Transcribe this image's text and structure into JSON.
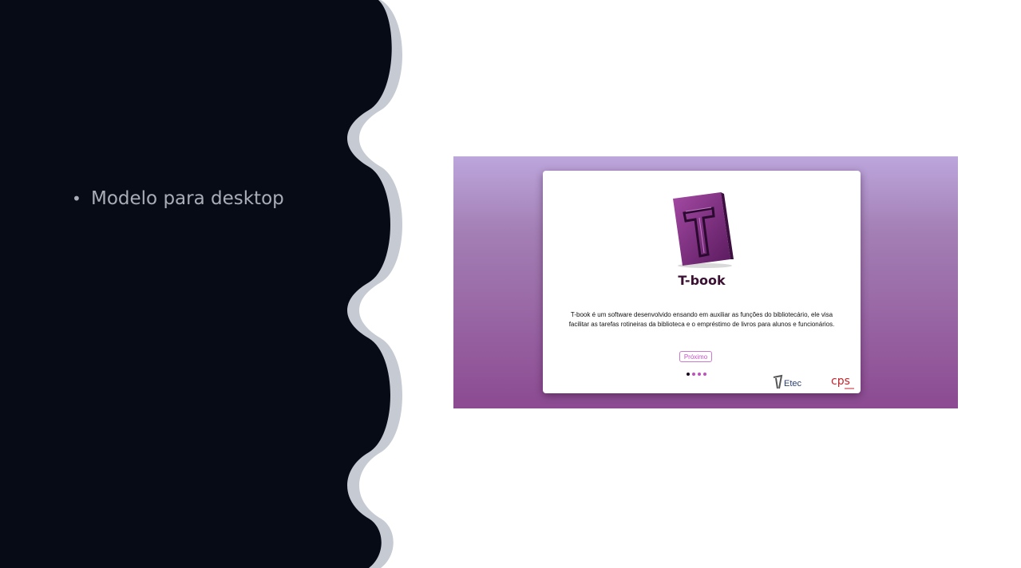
{
  "slide": {
    "bullet": "Modelo para desktop"
  },
  "mockup": {
    "app_title": "T-book",
    "description": "T-book é um software desenvolvido  ensando em auxiliar as funções do bibliotecário, ele visa facilitar as tarefas rotineiras da biblioteca e o empréstimo de livros para alunos e funcionários.",
    "next_button": "Próximo",
    "pagination": {
      "total": 4,
      "current": 1
    },
    "logos": {
      "etec": "Etec",
      "cps": "cps"
    }
  },
  "colors": {
    "dark_panel": "#060b16",
    "wave_border": "#c5cad3",
    "accent": "#c452c4",
    "title": "#3a1133"
  }
}
